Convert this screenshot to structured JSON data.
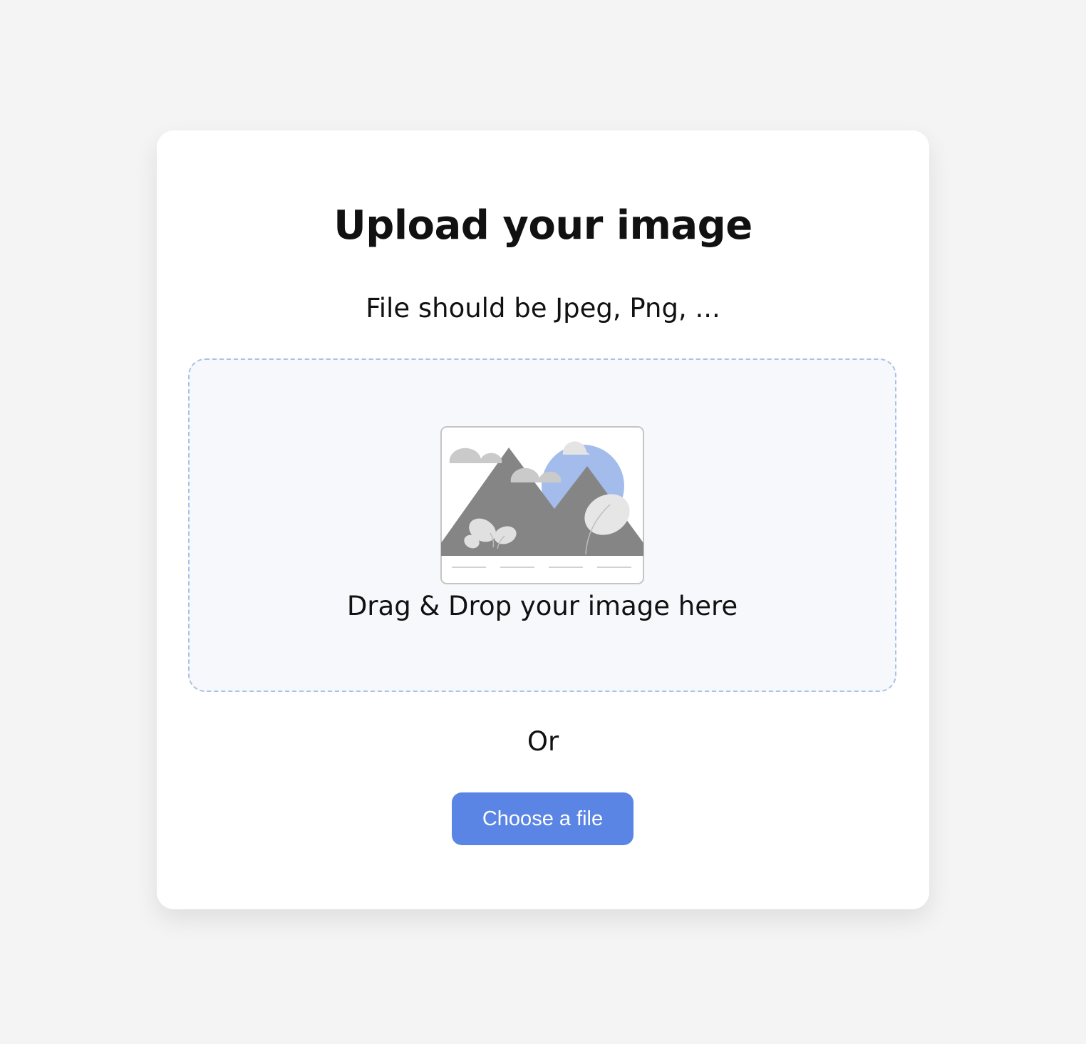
{
  "upload": {
    "title": "Upload your image",
    "subtitle": "File should be Jpeg, Png, ...",
    "dropzone_text": "Drag & Drop your image here",
    "or_text": "Or",
    "button_label": "Choose a file",
    "illustration_icon": "image-placeholder-icon"
  },
  "colors": {
    "page_background": "#f4f4f4",
    "card_background": "#ffffff",
    "dropzone_background": "#f6f8fb",
    "dropzone_border": "#aac2e8",
    "accent_button": "#5b85e5",
    "illustration_mountain": "#858585",
    "illustration_sun": "#a3bcec",
    "illustration_cloud": "#cacaca"
  }
}
